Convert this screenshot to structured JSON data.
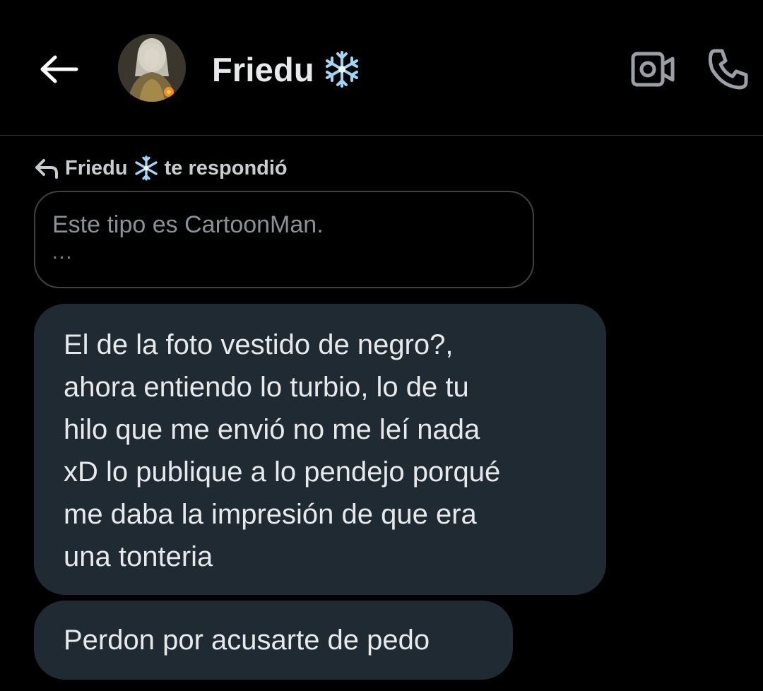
{
  "header": {
    "title": "Friedu",
    "title_emoji": "❄️",
    "back_icon": "arrow-left-icon",
    "video_icon": "video-call-icon",
    "phone_icon": "phone-icon"
  },
  "reply": {
    "author": "Friedu",
    "emoji": "❄️",
    "suffix": "te respondió",
    "quoted_text": "Este tipo es CartoonMan.",
    "quoted_more": "..."
  },
  "messages": [
    {
      "lines": [
        "El de la foto vestido de negro?,",
        "ahora entiendo lo turbio, lo de tu",
        "hilo que me envió no me leí nada",
        "xD lo publique a lo pendejo porqué",
        "me daba la impresión de que era",
        "una tonteria"
      ]
    },
    {
      "text": "Perdon por acusarte de pedo"
    }
  ],
  "colors": {
    "background": "#000000",
    "bubble": "#202a33",
    "text": "#e7e9ea",
    "muted": "#8b9197",
    "divider": "#2f3336",
    "snowflake": "#9fd6f5"
  }
}
